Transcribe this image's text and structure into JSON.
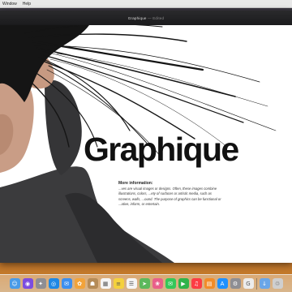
{
  "menubar": {
    "items": [
      "Window",
      "Help"
    ]
  },
  "window": {
    "title_app": "Graphique",
    "title_rest": " — Edited"
  },
  "content": {
    "headline": "Graphique",
    "info_heading": "More information:",
    "info_body": "...ves are visual images or designs. Often, these images combine illustrations, colors, ...ety of surfaces or artistic media, such as screens, walls, ...ound. The purpose of graphics can be functional or ...ative, inform, or entertain."
  },
  "dock": {
    "icons": [
      {
        "name": "finder-icon",
        "color": "#4a9be8",
        "glyph": "☺"
      },
      {
        "name": "siri-icon",
        "color": "#7c4de0",
        "glyph": "◉"
      },
      {
        "name": "launchpad-icon",
        "color": "#8e8e93",
        "glyph": "✦"
      },
      {
        "name": "safari-icon",
        "color": "#1e88e5",
        "glyph": "◎"
      },
      {
        "name": "mail-icon",
        "color": "#3d8ff0",
        "glyph": "✉"
      },
      {
        "name": "photos-app-icon",
        "color": "#f2a33a",
        "glyph": "✿"
      },
      {
        "name": "contacts-icon",
        "color": "#b58b57",
        "glyph": "☗"
      },
      {
        "name": "calendar-icon",
        "color": "#f5f5f5",
        "glyph": "▦"
      },
      {
        "name": "notes-icon",
        "color": "#f4d13d",
        "glyph": "≡"
      },
      {
        "name": "reminders-icon",
        "color": "#f5f5f5",
        "glyph": "☰"
      },
      {
        "name": "maps-icon",
        "color": "#5cb85c",
        "glyph": "➤"
      },
      {
        "name": "photos-icon",
        "color": "#e95f8a",
        "glyph": "❀"
      },
      {
        "name": "messages-icon",
        "color": "#35c759",
        "glyph": "✉"
      },
      {
        "name": "facetime-icon",
        "color": "#2fb34a",
        "glyph": "▶"
      },
      {
        "name": "music-icon",
        "color": "#fc3c44",
        "glyph": "♫"
      },
      {
        "name": "books-icon",
        "color": "#f28c28",
        "glyph": "▤"
      },
      {
        "name": "app-store-icon",
        "color": "#1e90ff",
        "glyph": "A"
      },
      {
        "name": "system-preferences-icon",
        "color": "#8e8e93",
        "glyph": "⚙"
      },
      {
        "name": "graphique-app-icon",
        "color": "#ececec",
        "glyph": "G"
      },
      {
        "name": "downloads-icon",
        "color": "#6aa6e8",
        "glyph": "↓"
      },
      {
        "name": "trash-icon",
        "color": "#cfcfcf",
        "glyph": "♲"
      }
    ]
  }
}
